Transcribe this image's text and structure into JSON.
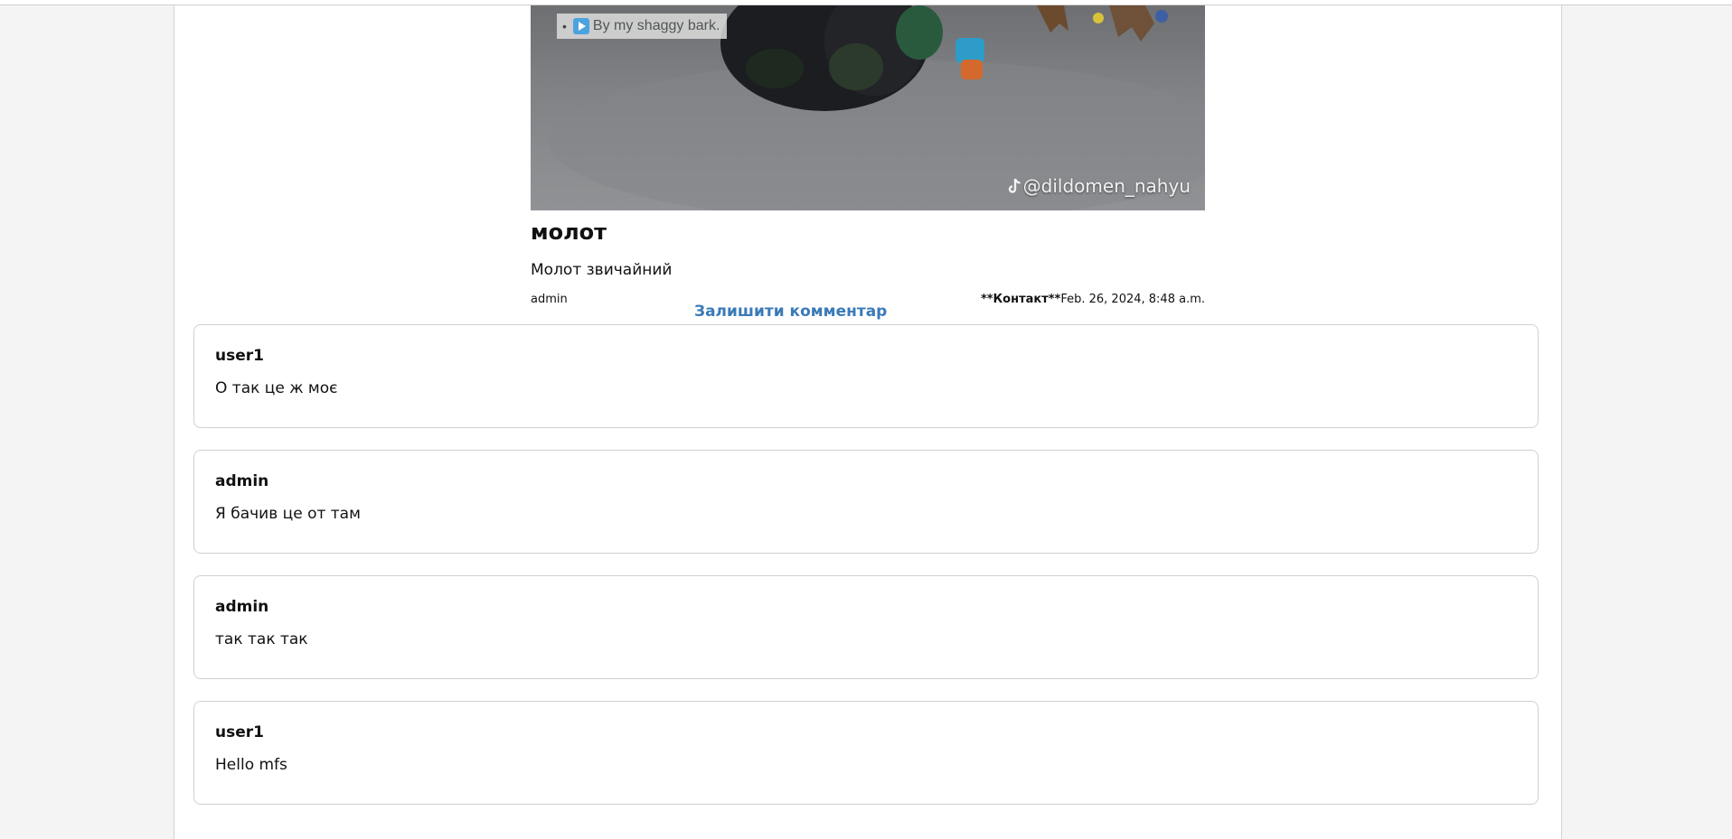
{
  "post": {
    "video_chip": "By my shaggy bark.",
    "watermark": "@dildomen_nahyu",
    "title": "молот",
    "body": "Молот звичайний",
    "author": "admin",
    "contact_label": "**Контакт**",
    "date": "Feb. 26, 2024, 8:48 a.m."
  },
  "leave_comment_label": "Залишити комментар",
  "comments": [
    {
      "author": "user1",
      "text": "О так це ж моє"
    },
    {
      "author": "admin",
      "text": "Я бачив це от там"
    },
    {
      "author": "admin",
      "text": "так так так"
    },
    {
      "author": "user1",
      "text": "Hello mfs"
    }
  ],
  "colors": {
    "link": "#3a7ab8",
    "page_background": "#f4f4f4",
    "card_border": "#d0d0d0"
  },
  "icons": [
    "play-icon",
    "tiktok-icon"
  ]
}
